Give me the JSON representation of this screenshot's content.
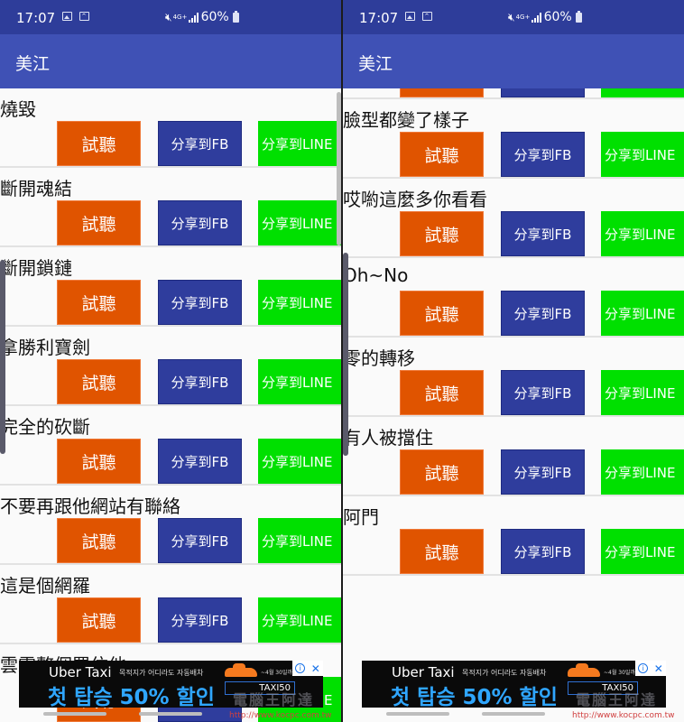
{
  "status_bar": {
    "time": "17:07",
    "icons": [
      "gallery-icon",
      "wifi-call-icon",
      "mute-icon",
      "4g-plus-icon",
      "signal-icon",
      "battery-icon"
    ],
    "network": "4G+",
    "battery": "60%"
  },
  "app_bar": {
    "title": "美江"
  },
  "buttons": {
    "listen": "試聽",
    "share_fb": "分享到FB",
    "share_line": "分享到LINE"
  },
  "colors": {
    "status_bar": "#2e3d9a",
    "app_bar": "#3f51b5",
    "listen_button": "#e05400",
    "fb_button": "#2f3d9d",
    "line_button": "#00e000"
  },
  "left_panel": {
    "items": [
      {
        "title": "燒毀"
      },
      {
        "title": "斷開魂結"
      },
      {
        "title": "斷開鎖鏈"
      },
      {
        "title": "拿勝利寶劍"
      },
      {
        "title": "完全的砍斷"
      },
      {
        "title": "不要再跟他網站有聯絡"
      },
      {
        "title": "這是個網羅"
      },
      {
        "title": "雲霧整個罩住他"
      }
    ]
  },
  "right_panel": {
    "items": [
      {
        "title": "雲霧整個罩住他"
      },
      {
        "title": "臉型都變了樣子"
      },
      {
        "title": "哎喲這麼多你看看"
      },
      {
        "title": "Oh~No"
      },
      {
        "title": "零的轉移"
      },
      {
        "title": "有人被擋住"
      },
      {
        "title": "阿門"
      }
    ]
  },
  "ad": {
    "brand": "Uber Taxi",
    "subtitle": "목적지가 어디라도 자동배차",
    "headline": "첫 탑승 50% 할인",
    "date_note": "~4월 30일까지",
    "promo_code": "TAXI50",
    "info_icon": "ⓘ",
    "close_icon": "✕"
  },
  "watermark": {
    "text": "電腦王阿達",
    "url": "http://www.kocpc.com.tw"
  }
}
